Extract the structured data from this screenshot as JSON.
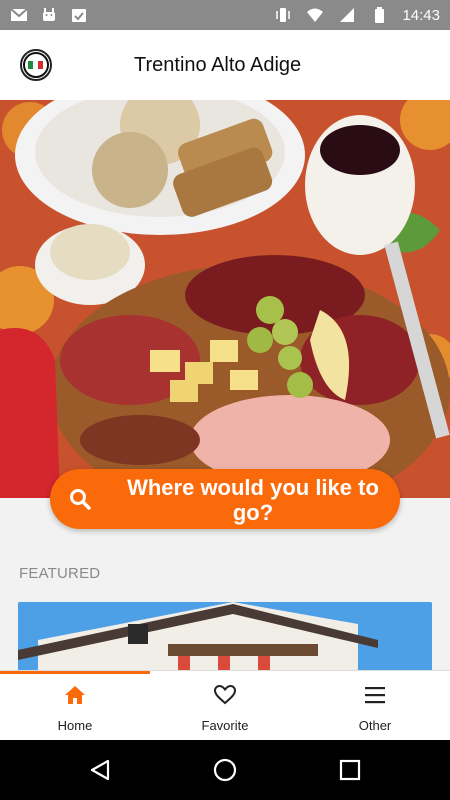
{
  "status_bar": {
    "time": "14:43"
  },
  "app_bar": {
    "title": "Trentino Alto Adige"
  },
  "search": {
    "label": "Where would you like to go?"
  },
  "featured": {
    "section_label": "FEATURED"
  },
  "bottom_nav": {
    "items": [
      {
        "label": "Home",
        "icon": "home-icon",
        "active": true
      },
      {
        "label": "Favorite",
        "icon": "heart-icon",
        "active": false
      },
      {
        "label": "Other",
        "icon": "menu-icon",
        "active": false
      }
    ]
  },
  "colors": {
    "accent": "#fb6a0a",
    "statusbar": "#8a8a8a"
  }
}
